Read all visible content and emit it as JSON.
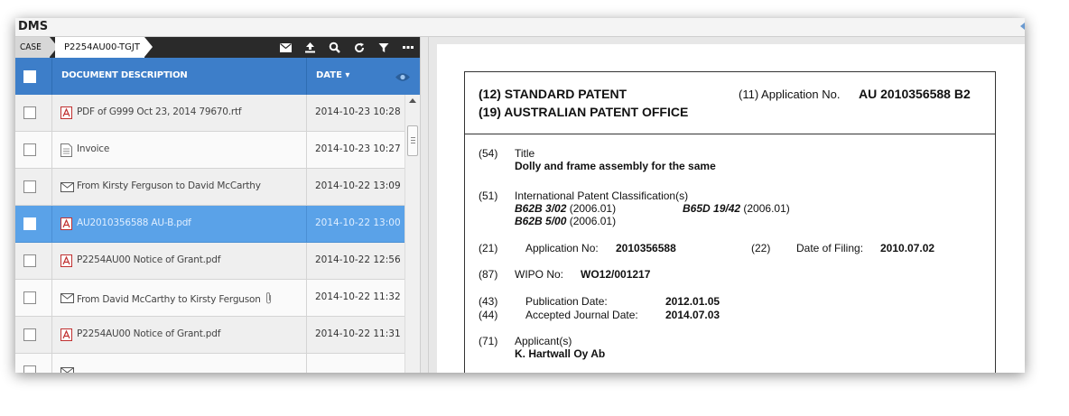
{
  "app": {
    "title": "DMS"
  },
  "breadcrumb": {
    "case_label": "CASE",
    "case_id": "P2254AU00-TGJT"
  },
  "toolbar": {
    "icons": [
      "envelope-icon",
      "upload-icon",
      "search-icon",
      "refresh-icon",
      "filter-icon",
      "more-icon"
    ]
  },
  "table": {
    "columns": {
      "description": "DOCUMENT DESCRIPTION",
      "date": "DATE ▾"
    },
    "rows": [
      {
        "icon": "pdf-icon",
        "description": "PDF of G999 Oct 23, 2014 79670.rtf",
        "date": "2014-10-23 10:28",
        "selected": false
      },
      {
        "icon": "document-icon",
        "description": "Invoice",
        "date": "2014-10-23 10:27",
        "selected": false
      },
      {
        "icon": "envelope-icon",
        "description": "From Kirsty Ferguson to David McCarthy",
        "date": "2014-10-22 13:09",
        "selected": false
      },
      {
        "icon": "pdf-icon",
        "description": "AU2010356588 AU-B.pdf",
        "date": "2014-10-22 13:00",
        "selected": true
      },
      {
        "icon": "pdf-icon",
        "description": "P2254AU00 Notice of Grant.pdf",
        "date": "2014-10-22 12:56",
        "selected": false
      },
      {
        "icon": "envelope-icon",
        "description": "From David McCarthy to Kirsty Ferguson",
        "date": "2014-10-22 11:32",
        "selected": false,
        "attachment": true
      },
      {
        "icon": "pdf-icon",
        "description": "P2254AU00 Notice of Grant.pdf",
        "date": "2014-10-22 11:31",
        "selected": false
      }
    ]
  },
  "document": {
    "header_left_1": "(12) STANDARD PATENT",
    "header_left_2": "(19) AUSTRALIAN PATENT OFFICE",
    "header_right_label": "(11) Application No.",
    "header_right_value": "AU  2010356588 B2",
    "f54_num": "(54)",
    "f54_label": "Title",
    "f54_value": "Dolly and frame assembly for the same",
    "f51_num": "(51)",
    "f51_label": "International Patent Classification(s)",
    "f51_c1_code": "B62B 3/02",
    "f51_c1_year": " (2006.01)",
    "f51_c2_code": "B65D 19/42",
    "f51_c2_year": " (2006.01)",
    "f51_c3_code": "B62B 5/00",
    "f51_c3_year": " (2006.01)",
    "f21_num": "(21)",
    "f21_label": "Application No:",
    "f21_value": "2010356588",
    "f22_num": "(22)",
    "f22_label": "Date of Filing:",
    "f22_value": "2010.07.02",
    "f87_num": "(87)",
    "f87_label": "WIPO No:",
    "f87_value": "WO12/001217",
    "f43_num": "(43)",
    "f43_label": "Publication Date:",
    "f43_value": "2012.01.05",
    "f44_num": "(44)",
    "f44_label": "Accepted Journal Date:",
    "f44_value": "2014.07.03",
    "f71_num": "(71)",
    "f71_label": "Applicant(s)",
    "f71_value": "K. Hartwall Oy Ab"
  }
}
